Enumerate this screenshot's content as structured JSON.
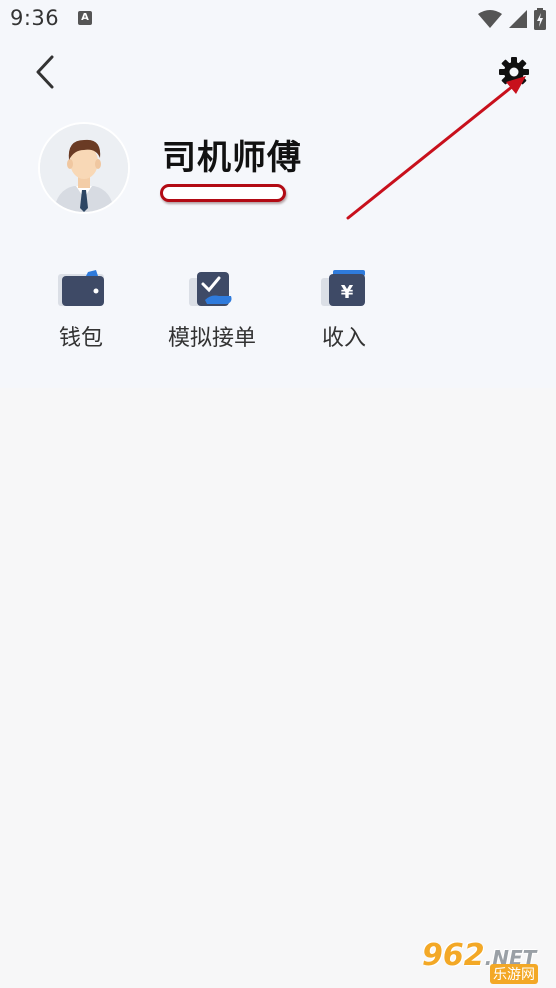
{
  "status_bar": {
    "time": "9:36",
    "notification_icon": "A"
  },
  "header": {
    "back_icon": "chevron-left-icon",
    "settings_icon": "gear-icon"
  },
  "profile": {
    "name": "司机师傅",
    "avatar_icon": "user-avatar-icon"
  },
  "quick_menu": {
    "items": [
      {
        "label": "钱包",
        "icon": "wallet-icon"
      },
      {
        "label": "模拟接单",
        "icon": "task-check-icon"
      },
      {
        "label": "收入",
        "icon": "yuan-card-icon"
      }
    ]
  },
  "watermark": {
    "brand": "962",
    "suffix": ".NET",
    "sub": "乐游网"
  },
  "colors": {
    "accent_blue": "#2f7bdc",
    "icon_dark": "#3e4a66",
    "annotation_red": "#c8101c",
    "background": "#f7f7f8"
  }
}
